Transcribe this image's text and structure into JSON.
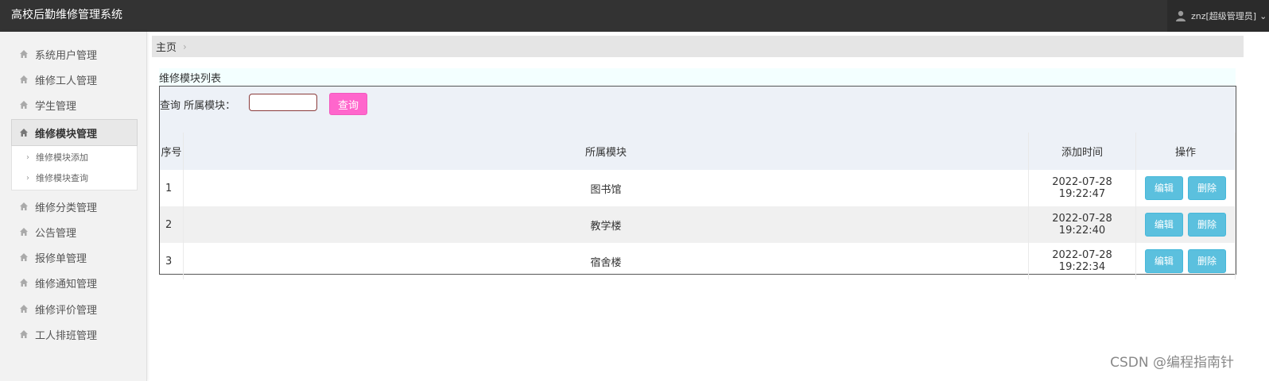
{
  "app": {
    "title": "高校后勤维修管理系统"
  },
  "user": {
    "label": "znz[超级管理员]"
  },
  "sidebar": {
    "items": [
      {
        "label": "系统用户管理"
      },
      {
        "label": "维修工人管理"
      },
      {
        "label": "学生管理"
      },
      {
        "label": "维修模块管理"
      },
      {
        "label": "维修分类管理"
      },
      {
        "label": "公告管理"
      },
      {
        "label": "报修单管理"
      },
      {
        "label": "维修通知管理"
      },
      {
        "label": "维修评价管理"
      },
      {
        "label": "工人排班管理"
      }
    ],
    "submenu": [
      {
        "label": "维修模块添加"
      },
      {
        "label": "维修模块查询"
      }
    ]
  },
  "breadcrumb": {
    "home": "主页"
  },
  "panel": {
    "title": "维修模块列表"
  },
  "search": {
    "label": "查询 所属模块：",
    "value": "",
    "button": "查询"
  },
  "table": {
    "headers": [
      "序号",
      "所属模块",
      "添加时间",
      "操作"
    ],
    "rows": [
      {
        "no": "1",
        "module": "图书馆",
        "time": "2022-07-28 19:22:47"
      },
      {
        "no": "2",
        "module": "教学楼",
        "time": "2022-07-28 19:22:40"
      },
      {
        "no": "3",
        "module": "宿舍楼",
        "time": "2022-07-28 19:22:34"
      }
    ],
    "edit_label": "编辑",
    "delete_label": "删除"
  },
  "watermark": "CSDN @编程指南针",
  "colors": {
    "topbar": "#333333",
    "search_button": "#ff66cc",
    "action_button": "#5bc0de"
  }
}
